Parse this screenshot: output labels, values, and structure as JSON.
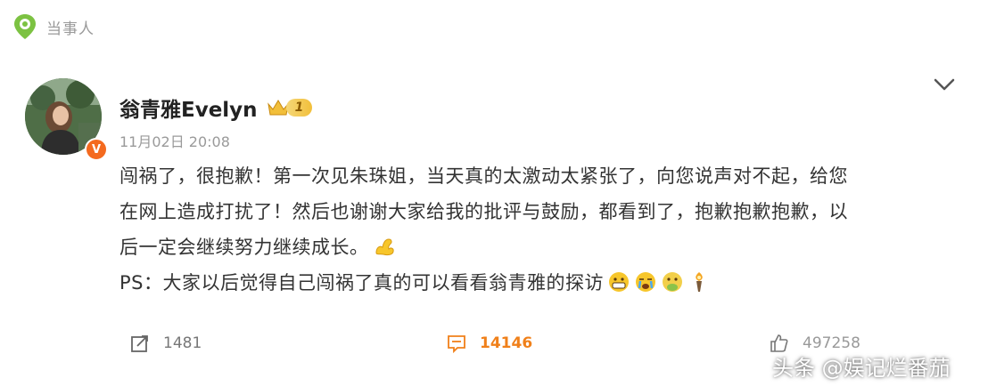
{
  "section_tag": "当事人",
  "post": {
    "author": "翁青雅Evelyn",
    "level": "1",
    "timestamp": "11月02日  20:08",
    "lines": [
      "闯祸了，很抱歉！第一次见朱珠姐，当天真的太激动太紧张了，向您说声对不起，给您",
      "在网上造成打扰了！然后也谢谢大家给我的批评与鼓励，都看到了，抱歉抱歉抱歉，以",
      "后一定会继续努力继续成长。",
      "PS：大家以后觉得自己闯祸了真的可以看看翁青雅的探访"
    ],
    "emojis_line3": [
      "flexed-arm"
    ],
    "emojis_line4": [
      "grimace",
      "crying",
      "nauseated",
      "torch"
    ]
  },
  "actions": {
    "repost_count": "1481",
    "comment_count": "14146",
    "like_count": "497258"
  },
  "watermark": "头条 @娱记烂番茄",
  "colors": {
    "accent_orange": "#f0801a",
    "verified": "#f46a1f",
    "gold": "#f2bf3a",
    "green_pin": "#7cc242"
  }
}
